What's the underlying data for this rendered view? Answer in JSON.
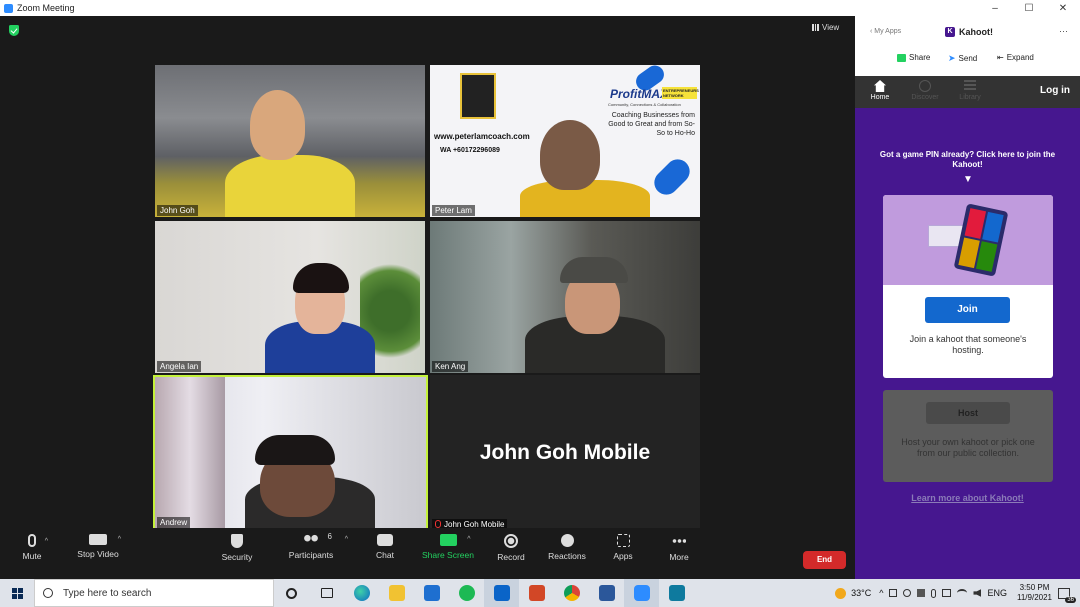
{
  "window": {
    "title": "Zoom Meeting",
    "controls": [
      "–",
      "☐",
      "✕"
    ]
  },
  "view_label": "View",
  "participants": [
    {
      "name": "John Goh"
    },
    {
      "name": "Peter Lam"
    },
    {
      "name": "Angela Ian"
    },
    {
      "name": "Ken Ang"
    },
    {
      "name": "Andrew"
    },
    {
      "name": "John Goh Mobile",
      "display": "John Goh Mobile"
    }
  ],
  "promo": {
    "brand": "ProfitMAX",
    "brand_sub": "ENTREPRENEURS NETWORK",
    "tagline": "Community, Connections & Collaboration",
    "text": "Coaching Businesses from Good to Great and from So-So to Ho-Ho",
    "url": "www.peterlamcoach.com",
    "wa": "WA +60172296089"
  },
  "toolbar": {
    "mute": "Mute",
    "stop_video": "Stop Video",
    "security": "Security",
    "participants": "Participants",
    "participants_count": "6",
    "chat": "Chat",
    "share_screen": "Share Screen",
    "record": "Record",
    "reactions": "Reactions",
    "apps": "Apps",
    "more": "More",
    "end": "End"
  },
  "kahoot": {
    "back": "My Apps",
    "title": "Kahoot!",
    "share": "Share",
    "send": "Send",
    "expand": "Expand",
    "nav": [
      "Home",
      "Discover",
      "Library"
    ],
    "login": "Log in",
    "pin_prompt": "Got a game PIN already? Click here to join the Kahoot!",
    "join": "Join",
    "join_desc": "Join a kahoot that someone's hosting.",
    "host": "Host",
    "host_desc": "Host your own kahoot or pick one from our public collection.",
    "learn_more": "Learn more about Kahoot!"
  },
  "taskbar": {
    "search_placeholder": "Type here to search",
    "weather": "33°C",
    "lang": "ENG",
    "time": "3:50 PM",
    "date": "11/9/2021",
    "notif_count": "36"
  },
  "colors": {
    "active_speaker": "#c4f23a",
    "end_button": "#d32a2a",
    "kahoot_purple": "#46178f",
    "join_blue": "#1368ce"
  }
}
